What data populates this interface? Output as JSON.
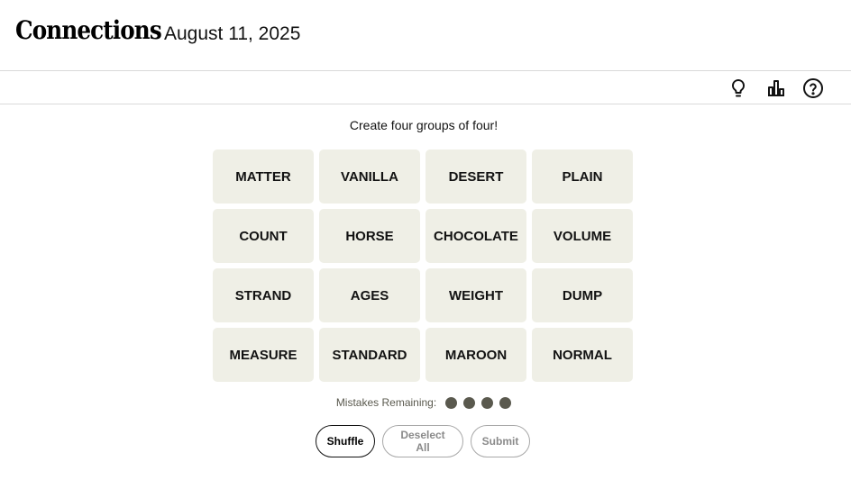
{
  "header": {
    "title": "Connections",
    "date": "August 11, 2025"
  },
  "toolbar": {
    "icons": [
      "lightbulb-icon",
      "bar-chart-icon",
      "help-icon"
    ]
  },
  "instructions": "Create four groups of four!",
  "tiles": [
    "MATTER",
    "VANILLA",
    "DESERT",
    "PLAIN",
    "COUNT",
    "HORSE",
    "CHOCOLATE",
    "VOLUME",
    "STRAND",
    "AGES",
    "WEIGHT",
    "DUMP",
    "MEASURE",
    "STANDARD",
    "MAROON",
    "NORMAL"
  ],
  "mistakes": {
    "label": "Mistakes Remaining:",
    "remaining": 4
  },
  "buttons": {
    "shuffle": "Shuffle",
    "deselect": "Deselect All",
    "submit": "Submit"
  },
  "colors": {
    "tile_background": "#efefe6",
    "dot": "#5a594e",
    "disabled_border": "#a8a8a8"
  }
}
